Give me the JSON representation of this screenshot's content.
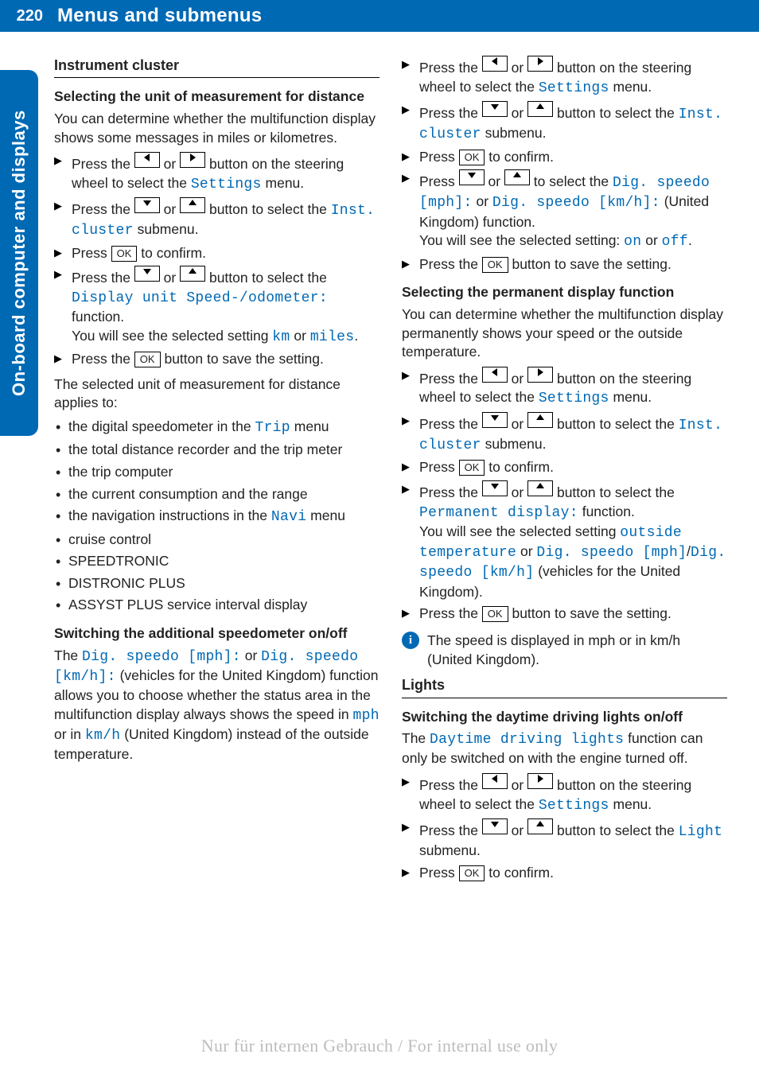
{
  "header": {
    "page_number": "220",
    "title": "Menus and submenus"
  },
  "side_tab": "On-board computer and displays",
  "left": {
    "h1": "Instrument cluster",
    "sec1_h2": "Selecting the unit of measurement for distance",
    "sec1_intro": "You can determine whether the multifunction display shows some messages in miles or kilometres.",
    "sec1_steps": {
      "s1a": "Press the ",
      "s1b": " or ",
      "s1c": " button on the steering wheel to select the ",
      "s1menu": "Settings",
      "s1d": " menu.",
      "s2a": "Press the ",
      "s2b": " or ",
      "s2c": " button to select the ",
      "s2menu": "Inst. cluster",
      "s2d": " submenu.",
      "s3a": "Press ",
      "s3ok": "OK",
      "s3b": " to confirm.",
      "s4a": "Press the ",
      "s4b": " or ",
      "s4c": " button to select the ",
      "s4menu": "Display unit Speed-/odometer:",
      "s4d": " function.",
      "s4e": "You will see the selected setting ",
      "s4km": "km",
      "s4f": " or ",
      "s4miles": "miles",
      "s4g": ".",
      "s5a": "Press the ",
      "s5ok": "OK",
      "s5b": " button to save the setting."
    },
    "applies_intro": "The selected unit of measurement for distance applies to:",
    "applies": {
      "b1a": "the digital speedometer in the ",
      "b1menu": "Trip",
      "b1b": " menu",
      "b2": "the total distance recorder and the trip meter",
      "b3": "the trip computer",
      "b4": "the current consumption and the range",
      "b5a": "the navigation instructions in the ",
      "b5menu": "Navi",
      "b5b": " menu",
      "b6": "cruise control",
      "b7": "SPEEDTRONIC",
      "b8": "DISTRONIC PLUS",
      "b9": "ASSYST PLUS service interval display"
    },
    "sec2_h2": "Switching the additional speedometer on/off",
    "sec2_p_a": "The ",
    "sec2_m1": "Dig. speedo [mph]:",
    "sec2_p_b": " or ",
    "sec2_m2": "Dig. speedo [km/h]:",
    "sec2_p_c": " (vehicles for the United Kingdom) function allows you to choose whether the status area in the multifunction display always shows the speed in ",
    "sec2_m3": "mph",
    "sec2_p_d": " or in ",
    "sec2_m4": "km/h",
    "sec2_p_e": " (United Kingdom) instead of the outside temperature."
  },
  "right": {
    "top_steps": {
      "s1a": "Press the ",
      "s1b": " or ",
      "s1c": " button on the steering wheel to select the ",
      "s1menu": "Settings",
      "s1d": " menu.",
      "s2a": "Press the ",
      "s2b": " or ",
      "s2c": " button to select the ",
      "s2menu": "Inst. cluster",
      "s2d": " submenu.",
      "s3a": "Press ",
      "s3ok": "OK",
      "s3b": " to confirm.",
      "s4a": "Press ",
      "s4b": " or ",
      "s4c": " to select the ",
      "s4m1": "Dig. speedo [mph]:",
      "s4d": " or ",
      "s4m2": "Dig. speedo [km/h]:",
      "s4e": " (United Kingdom) function.",
      "s4f": "You will see the selected setting: ",
      "s4on": "on",
      "s4g": " or ",
      "s4off": "off",
      "s4h": ".",
      "s5a": "Press the ",
      "s5ok": "OK",
      "s5b": " button to save the setting."
    },
    "sec3_h2": "Selecting the permanent display function",
    "sec3_intro": "You can determine whether the multifunction display permanently shows your speed or the outside temperature.",
    "sec3_steps": {
      "s1a": "Press the ",
      "s1b": " or ",
      "s1c": " button on the steering wheel to select the ",
      "s1menu": "Settings",
      "s1d": " menu.",
      "s2a": "Press the ",
      "s2b": " or ",
      "s2c": " button to select the ",
      "s2menu": "Inst. cluster",
      "s2d": " submenu.",
      "s3a": "Press ",
      "s3ok": "OK",
      "s3b": " to confirm.",
      "s4a": "Press the ",
      "s4b": " or ",
      "s4c": " button to select the ",
      "s4menu": "Permanent display:",
      "s4d": " function.",
      "s4e": "You will see the selected setting ",
      "s4m1": "outside temperature",
      "s4f": " or ",
      "s4m2": "Dig. speedo [mph]",
      "s4g": "/",
      "s4m3": "Dig. speedo [km/h]",
      "s4h": " (vehicles for the United Kingdom).",
      "s5a": "Press the ",
      "s5ok": "OK",
      "s5b": " button to save the setting."
    },
    "info": "The speed is displayed in mph or in km/h (United Kingdom).",
    "h1_lights": "Lights",
    "sec4_h2": "Switching the daytime driving lights on/off",
    "sec4_p_a": "The ",
    "sec4_m1": "Daytime driving lights",
    "sec4_p_b": " function can only be switched on with the engine turned off.",
    "sec4_steps": {
      "s1a": "Press the ",
      "s1b": " or ",
      "s1c": " button on the steering wheel to select the ",
      "s1menu": "Settings",
      "s1d": " menu.",
      "s2a": "Press the ",
      "s2b": " or ",
      "s2c": " button to select the ",
      "s2menu": "Light",
      "s2d": " submenu.",
      "s3a": "Press ",
      "s3ok": "OK",
      "s3b": " to confirm."
    }
  },
  "watermark": "Nur für internen Gebrauch / For internal use only"
}
